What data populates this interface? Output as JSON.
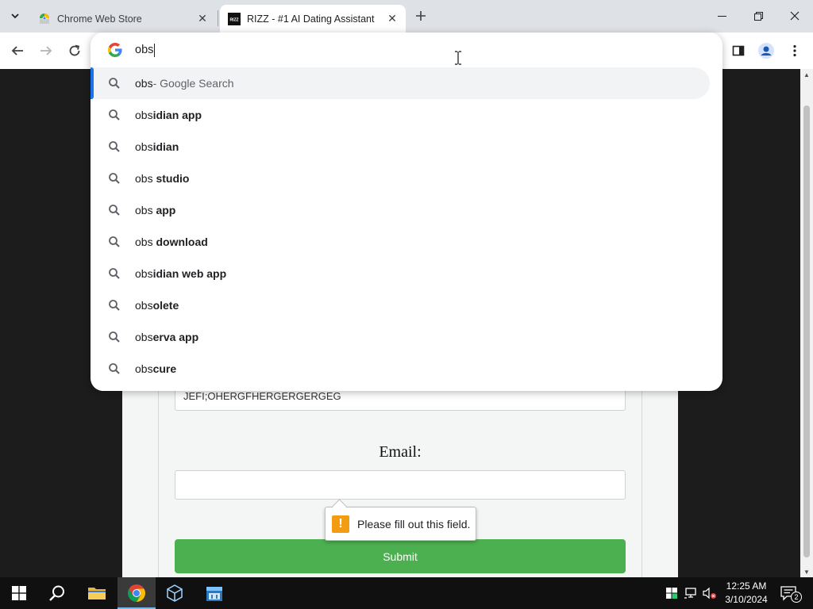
{
  "browser": {
    "tabs": [
      {
        "title": "Chrome Web Store",
        "active": false
      },
      {
        "title": "RIZZ - #1 AI Dating Assistant",
        "active": true
      }
    ],
    "favicon_rizz_text": "RIZZ",
    "accent_color": "#1a73e8"
  },
  "omnibox": {
    "typed_text": "obs",
    "suggestions": [
      {
        "prefix": "obs",
        "bold": "",
        "suffix": " - Google Search",
        "selected": true
      },
      {
        "prefix": "obs",
        "bold": "idian app",
        "suffix": ""
      },
      {
        "prefix": "obs",
        "bold": "idian",
        "suffix": ""
      },
      {
        "prefix": "obs ",
        "bold": "studio",
        "suffix": ""
      },
      {
        "prefix": "obs ",
        "bold": "app",
        "suffix": ""
      },
      {
        "prefix": "obs ",
        "bold": "download",
        "suffix": ""
      },
      {
        "prefix": "obs",
        "bold": "idian web app",
        "suffix": ""
      },
      {
        "prefix": "obs",
        "bold": "olete",
        "suffix": ""
      },
      {
        "prefix": "obs",
        "bold": "erva app",
        "suffix": ""
      },
      {
        "prefix": "obs",
        "bold": "cure",
        "suffix": ""
      }
    ]
  },
  "page": {
    "filled_input_value": "JEFI;OHERGFHERGERGERGEG",
    "email_label": "Email:",
    "email_value": "",
    "validation_message": "Please fill out this field.",
    "submit_label": "Submit",
    "submit_color": "#4caf50"
  },
  "taskbar": {
    "time": "12:25 AM",
    "date": "3/10/2024",
    "notification_count": "2"
  }
}
